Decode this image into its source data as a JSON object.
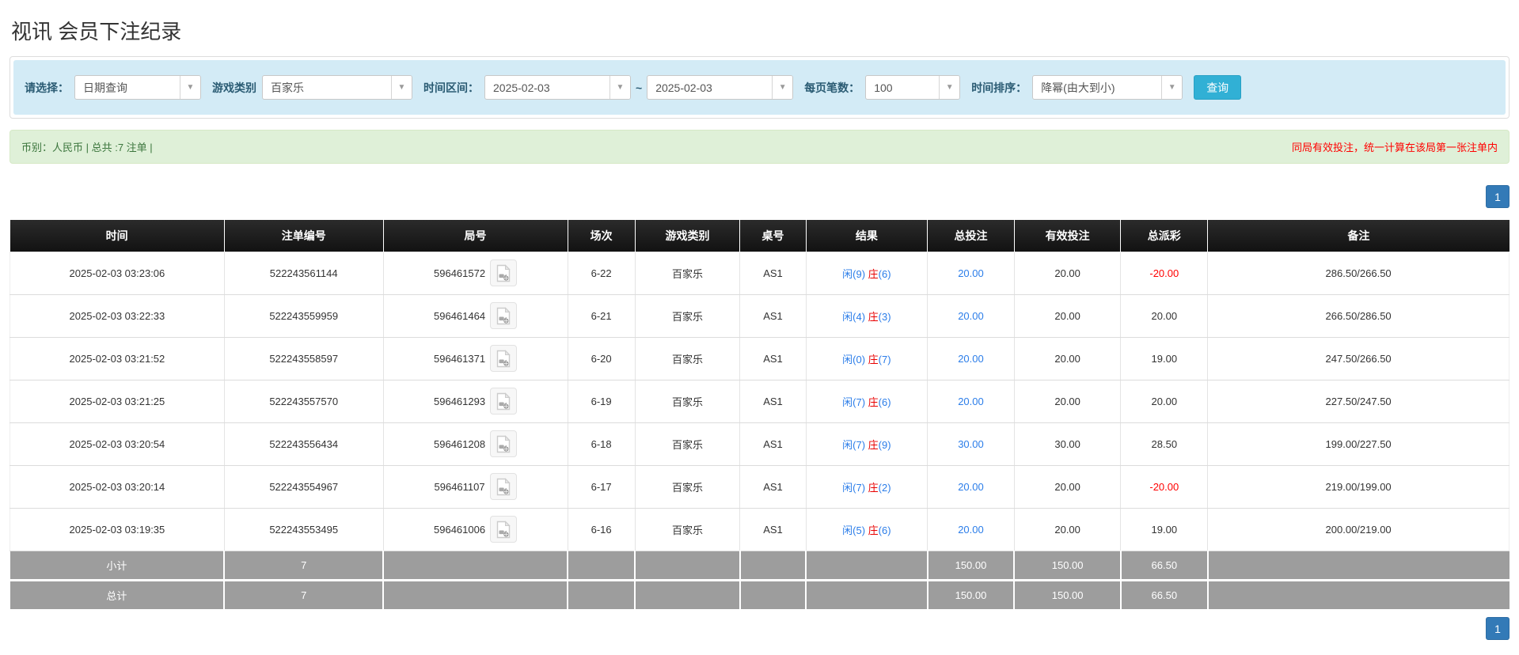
{
  "page": {
    "title": "视讯 会员下注纪录"
  },
  "filters": {
    "select_label": "请选择：",
    "select_value": "日期查询",
    "game_label": "游戏类别",
    "game_value": "百家乐",
    "range_label": "时间区间：",
    "date_from": "2025-02-03",
    "tilde": "~",
    "date_to": "2025-02-03",
    "page_size_label": "每页笔数：",
    "page_size_value": "100",
    "sort_label": "时间排序：",
    "sort_value": "降幂(由大到小)",
    "search_button": "查询"
  },
  "summary": {
    "currency_total": "币别：人民币 | 总共 :7 注单 |",
    "notice": "同局有效投注，统一计算在该局第一张注单内"
  },
  "pagination": {
    "page": "1"
  },
  "colors": {
    "accent_blue": "#2b7de9",
    "negative_red": "#ff0000",
    "banker_red": "#e80000",
    "header_bg": "#1b1b1b",
    "footer_bg": "#9d9d9d",
    "search_button_blue": "#31b0d5",
    "pager_blue": "#337ab7",
    "filter_bar_bg": "#d3ebf6",
    "summary_bg": "#dff0d8"
  },
  "table": {
    "headers": [
      "时间",
      "注单编号",
      "局号",
      "场次",
      "游戏类别",
      "桌号",
      "结果",
      "总投注",
      "有效投注",
      "总派彩",
      "备注"
    ],
    "video_icon_name": "video-record-icon",
    "rows": [
      {
        "time": "2025-02-03 03:23:06",
        "bet_id": "522243561144",
        "round_id": "596461572",
        "session": "6-22",
        "game": "百家乐",
        "table_no": "AS1",
        "result_player": "闲(9)",
        "result_banker": "庄",
        "result_banker_num": "(6)",
        "total_bet": "20.00",
        "valid_bet": "20.00",
        "payout": "-20.00",
        "remark": "286.50/266.50"
      },
      {
        "time": "2025-02-03 03:22:33",
        "bet_id": "522243559959",
        "round_id": "596461464",
        "session": "6-21",
        "game": "百家乐",
        "table_no": "AS1",
        "result_player": "闲(4)",
        "result_banker": "庄",
        "result_banker_num": "(3)",
        "total_bet": "20.00",
        "valid_bet": "20.00",
        "payout": "20.00",
        "remark": "266.50/286.50"
      },
      {
        "time": "2025-02-03 03:21:52",
        "bet_id": "522243558597",
        "round_id": "596461371",
        "session": "6-20",
        "game": "百家乐",
        "table_no": "AS1",
        "result_player": "闲(0)",
        "result_banker": "庄",
        "result_banker_num": "(7)",
        "total_bet": "20.00",
        "valid_bet": "20.00",
        "payout": "19.00",
        "remark": "247.50/266.50"
      },
      {
        "time": "2025-02-03 03:21:25",
        "bet_id": "522243557570",
        "round_id": "596461293",
        "session": "6-19",
        "game": "百家乐",
        "table_no": "AS1",
        "result_player": "闲(7)",
        "result_banker": "庄",
        "result_banker_num": "(6)",
        "total_bet": "20.00",
        "valid_bet": "20.00",
        "payout": "20.00",
        "remark": "227.50/247.50"
      },
      {
        "time": "2025-02-03 03:20:54",
        "bet_id": "522243556434",
        "round_id": "596461208",
        "session": "6-18",
        "game": "百家乐",
        "table_no": "AS1",
        "result_player": "闲(7)",
        "result_banker": "庄",
        "result_banker_num": "(9)",
        "total_bet": "30.00",
        "valid_bet": "30.00",
        "payout": "28.50",
        "remark": "199.00/227.50"
      },
      {
        "time": "2025-02-03 03:20:14",
        "bet_id": "522243554967",
        "round_id": "596461107",
        "session": "6-17",
        "game": "百家乐",
        "table_no": "AS1",
        "result_player": "闲(7)",
        "result_banker": "庄",
        "result_banker_num": "(2)",
        "total_bet": "20.00",
        "valid_bet": "20.00",
        "payout": "-20.00",
        "remark": "219.00/199.00"
      },
      {
        "time": "2025-02-03 03:19:35",
        "bet_id": "522243553495",
        "round_id": "596461006",
        "session": "6-16",
        "game": "百家乐",
        "table_no": "AS1",
        "result_player": "闲(5)",
        "result_banker": "庄",
        "result_banker_num": "(6)",
        "total_bet": "20.00",
        "valid_bet": "20.00",
        "payout": "19.00",
        "remark": "200.00/219.00"
      }
    ],
    "subtotal": {
      "label": "小计",
      "count": "7",
      "total_bet": "150.00",
      "valid_bet": "150.00",
      "payout": "66.50"
    },
    "total": {
      "label": "总计",
      "count": "7",
      "total_bet": "150.00",
      "valid_bet": "150.00",
      "payout": "66.50"
    }
  }
}
